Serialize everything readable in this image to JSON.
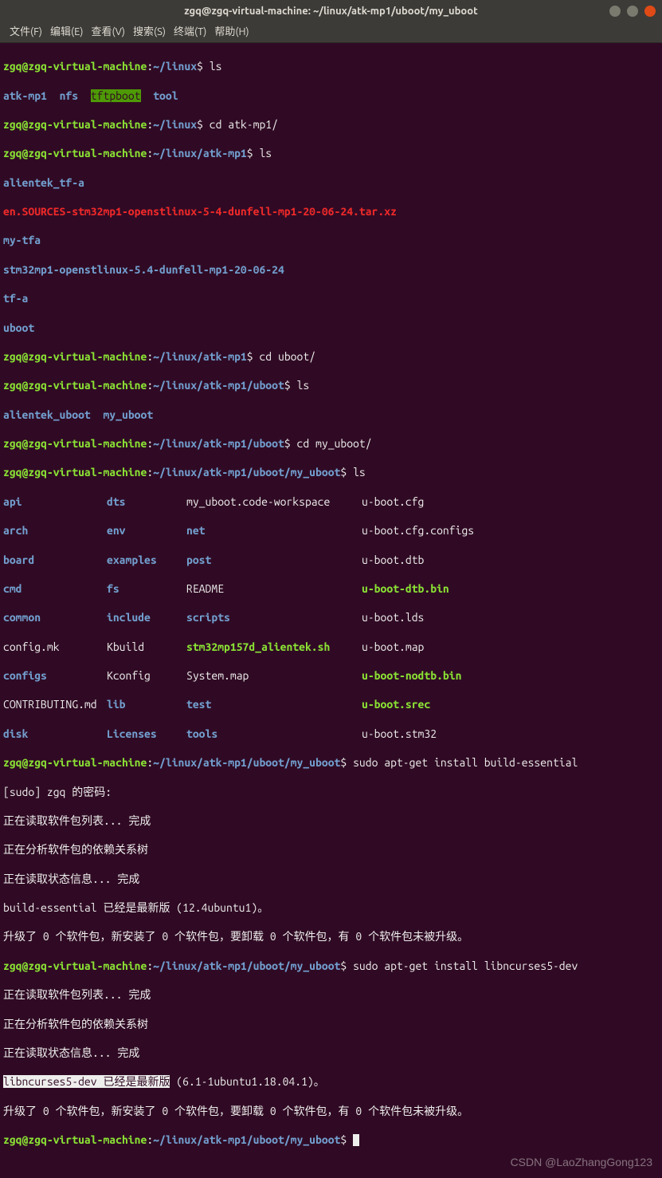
{
  "window": {
    "title": "zgq@zgq-virtual-machine: ~/linux/atk-mp1/uboot/my_uboot"
  },
  "menubar": {
    "file": "文件(F)",
    "edit": "编辑(E)",
    "view": "查看(V)",
    "search": "搜索(S)",
    "terminal": "终端(T)",
    "help": "帮助(H)"
  },
  "prompts": {
    "user": "zgq@zgq-virtual-machine",
    "p0": "~/linux",
    "p1": "~/linux/atk-mp1",
    "p2": "~/linux/atk-mp1/uboot",
    "p3": "~/linux/atk-mp1/uboot/my_uboot"
  },
  "cmds": {
    "ls": "ls",
    "cd_atk": "cd atk-mp1/",
    "cd_uboot": "cd uboot/",
    "cd_my": "cd my_uboot/",
    "apt_be": "sudo apt-get install build-essential",
    "apt_nc": "sudo apt-get install libncurses5-dev"
  },
  "ls1": {
    "c0": "atk-mp1",
    "c1": "nfs",
    "c2": "tftpboot",
    "c3": "tool"
  },
  "ls2": {
    "l0": "alientek_tf-a",
    "l1": "en.SOURCES-stm32mp1-openstlinux-5-4-dunfell-mp1-20-06-24.tar.xz",
    "l2": "my-tfa",
    "l3": "stm32mp1-openstlinux-5.4-dunfell-mp1-20-06-24",
    "l4": "tf-a",
    "l5": "uboot"
  },
  "ls3": {
    "c0": "alientek_uboot",
    "c1": "my_uboot"
  },
  "ls4": {
    "r0": {
      "c0": "api",
      "c1": "dts",
      "c2": "my_uboot.code-workspace",
      "c3": "u-boot.cfg"
    },
    "r1": {
      "c0": "arch",
      "c1": "env",
      "c2": "net",
      "c3": "u-boot.cfg.configs"
    },
    "r2": {
      "c0": "board",
      "c1": "examples",
      "c2": "post",
      "c3": "u-boot.dtb"
    },
    "r3": {
      "c0": "cmd",
      "c1": "fs",
      "c2": "README",
      "c3": "u-boot-dtb.bin"
    },
    "r4": {
      "c0": "common",
      "c1": "include",
      "c2": "scripts",
      "c3": "u-boot.lds"
    },
    "r5": {
      "c0": "config.mk",
      "c1": "Kbuild",
      "c2": "stm32mp157d_alientek.sh",
      "c3": "u-boot.map"
    },
    "r6": {
      "c0": "configs",
      "c1": "Kconfig",
      "c2": "System.map",
      "c3": "u-boot-nodtb.bin"
    },
    "r7": {
      "c0": "CONTRIBUTING.md",
      "c1": "lib",
      "c2": "test",
      "c3": "u-boot.srec"
    },
    "r8": {
      "c0": "disk",
      "c1": "Licenses",
      "c2": "tools",
      "c3": "u-boot.stm32"
    }
  },
  "apt1": {
    "sudo_pw": "[sudo] zgq 的密码:",
    "reading": "正在读取软件包列表... 完成",
    "deptree": "正在分析软件包的依赖关系树",
    "state": "正在读取状态信息... 完成",
    "be_newest": "build-essential 已经是最新版 (12.4ubuntu1)。",
    "upgrade": "升级了 0 个软件包，新安装了 0 个软件包，要卸载 0 个软件包，有 0 个软件包未被升级。"
  },
  "apt2": {
    "nc_name": "libncurses5-dev",
    "nc_rest": " 已经是最新版",
    "nc_ver": " (6.1-1ubuntu1.18.04.1)。"
  },
  "watermark": "CSDN @LaoZhangGong123"
}
